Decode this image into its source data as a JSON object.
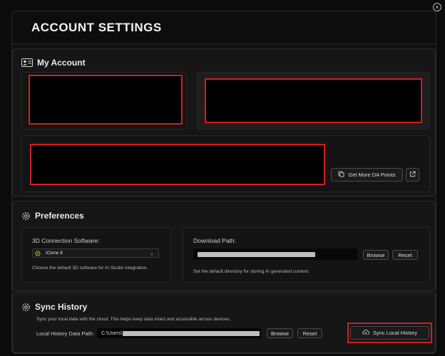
{
  "window": {
    "title": "ACCOUNT SETTINGS",
    "close_glyph": "×"
  },
  "my_account": {
    "title": "My Account",
    "icon": "user-card-icon",
    "get_more_label": "Get More DA Points",
    "open_icon": "external-link-icon"
  },
  "preferences": {
    "title": "Preferences",
    "icon": "gear-icon",
    "connection_label": "3D Connection Software:",
    "software_selected": "iClone 8",
    "connection_hint": "Choose the default 3D software for AI Studio integration.",
    "download_label": "Download Path:",
    "browse_label": "Browse",
    "reset_label": "Reset",
    "download_hint": "Set the default directory for storing AI generated content."
  },
  "sync": {
    "title": "Sync History",
    "icon": "gear-icon",
    "description": "Sync your local data with the cloud. This helps keep data intact and accessible across devices.",
    "local_path_label": "Local History Data Path:",
    "local_path_value": "C:\\Users\\",
    "browse_label": "Browse",
    "reset_label": "Reset",
    "sync_button_label": "Sync Local History"
  },
  "colors": {
    "highlight": "#d01f1f",
    "background": "#111111"
  }
}
